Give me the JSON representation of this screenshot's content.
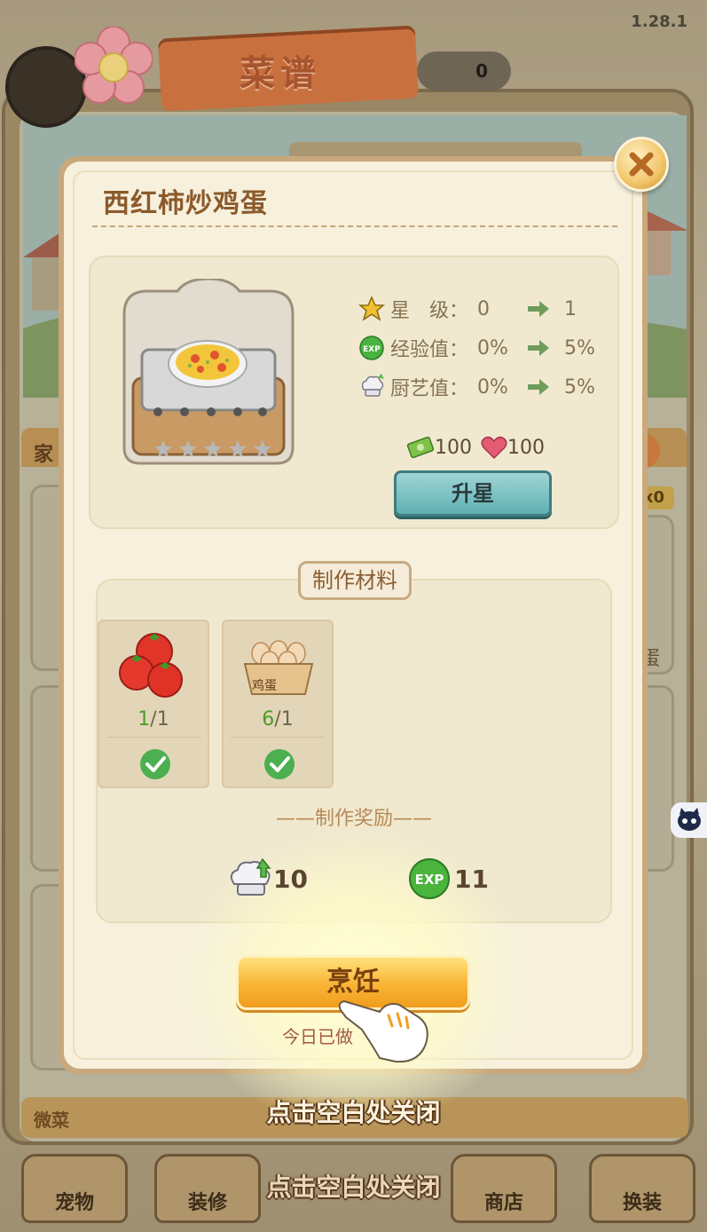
{
  "app": {
    "version": "1.28.1",
    "coin_value": "0"
  },
  "title_ribbon": {
    "label": "菜谱"
  },
  "background": {
    "section_label": "家",
    "right_label": "蛋",
    "right_badge": "x0",
    "bottom_strip_label": "微菜"
  },
  "modal": {
    "dish_name": "西红柿炒鸡蛋",
    "stats": [
      {
        "label": "星　级：",
        "from": "0",
        "to": "1",
        "icon": "star-icon"
      },
      {
        "label": "经验值：",
        "from": "0%",
        "to": "5%",
        "icon": "exp-icon"
      },
      {
        "label": "厨艺值：",
        "from": "0%",
        "to": "5%",
        "icon": "chef-hat-icon"
      }
    ],
    "star_rating": 0,
    "cost": {
      "cash": "100",
      "heart": "100"
    },
    "upgrade_button": "升星",
    "materials_header": "制作材料",
    "materials": [
      {
        "name": "tomato",
        "have": "1",
        "need": "1"
      },
      {
        "name": "eggs",
        "have": "6",
        "need": "1",
        "crate_label": "鸡蛋"
      }
    ],
    "reward_title": "——制作奖励——",
    "rewards": [
      {
        "icon": "chef-hat-icon",
        "value": "10"
      },
      {
        "icon": "exp-icon",
        "value": "11"
      }
    ],
    "cook_button": "烹饪",
    "today_text": "今日已做"
  },
  "bottom_tabs": [
    "宠物",
    "装修",
    "商店",
    "换装"
  ],
  "close_hint": "点击空白处关闭",
  "colors": {
    "accent_orange": "#f9b435",
    "title_brown": "#8b5a2b",
    "check_green": "#4caf50",
    "exp_green": "#3aa43a"
  }
}
